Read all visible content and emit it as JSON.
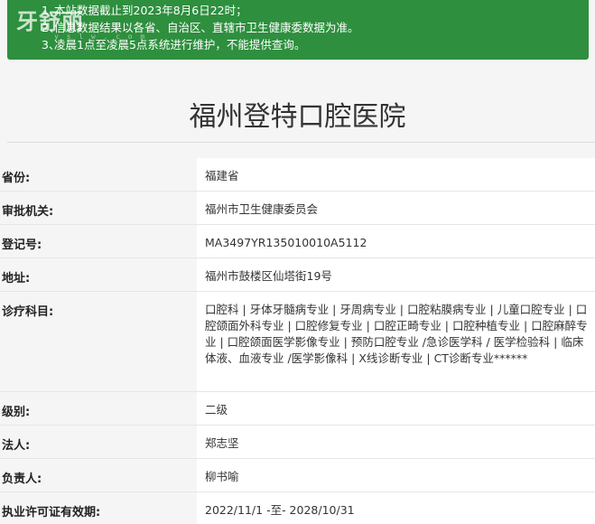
{
  "notice": {
    "logo_text": "牙舒丽",
    "logo_sub": "y s l w . c o m",
    "items": [
      {
        "num": "1、",
        "text": "本站数据截止到2023年8月6日22时；"
      },
      {
        "num": "2、",
        "text": "信息数据结果以各省、自治区、直辖市卫生健康委数据为准。"
      },
      {
        "num": "3、",
        "text": "凌晨1点至凌晨5点系统进行维护，不能提供查询。"
      }
    ]
  },
  "hospital_name": "福州登特口腔医院",
  "fields": [
    {
      "label": "省份:",
      "value": "福建省"
    },
    {
      "label": "审批机关:",
      "value": "福州市卫生健康委员会"
    },
    {
      "label": "登记号:",
      "value": "MA3497YR135010010A5112"
    },
    {
      "label": "地址:",
      "value": "福州市鼓楼区仙塔街19号"
    },
    {
      "label": "诊疗科目:",
      "value": "口腔科 | 牙体牙髓病专业 | 牙周病专业 | 口腔粘膜病专业 | 儿童口腔专业 | 口腔颌面外科专业 | 口腔修复专业 | 口腔正畸专业 | 口腔种植专业 | 口腔麻醉专业 | 口腔颌面医学影像专业 | 预防口腔专业 /急诊医学科 / 医学检验科 | 临床体液、血液专业 /医学影像科 | X线诊断专业 | CT诊断专业******"
    },
    {
      "label": "级别:",
      "value": "二级"
    },
    {
      "label": "法人:",
      "value": "郑志坚"
    },
    {
      "label": "负责人:",
      "value": "柳书喻"
    },
    {
      "label": "执业许可证有效期:",
      "value": "2022/11/1 -至- 2028/10/31"
    }
  ]
}
